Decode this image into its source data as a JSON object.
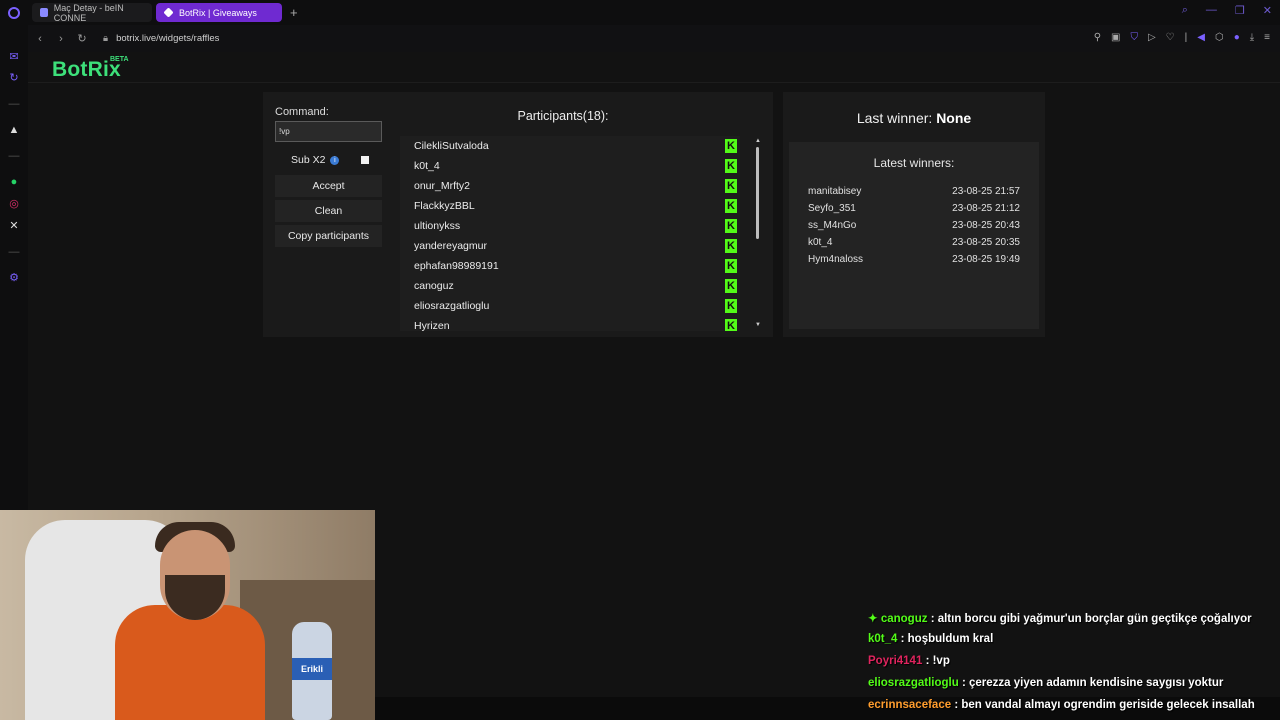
{
  "browser": {
    "tabs": [
      {
        "title": "Maç Detay - beIN CONNE"
      },
      {
        "title": "BotRix | Giveaways"
      }
    ],
    "new_tab": "+",
    "url": "botrix.live/widgets/raffles"
  },
  "brand": {
    "name": "BotRix",
    "badge": "BETA"
  },
  "command": {
    "label": "Command:",
    "value": "!vp",
    "sub_label": "Sub X2",
    "info": "i"
  },
  "buttons": {
    "accept": "Accept",
    "clean": "Clean",
    "copy": "Copy participants"
  },
  "participants": {
    "title": "Participants(18):",
    "platform_icon": "K",
    "items": [
      "CilekliSutvaloda",
      "k0t_4",
      "onur_Mrfty2",
      "FlackkyzBBL",
      "ultionykss",
      "yandereyagmur",
      "ephafan98989191",
      "canoguz",
      "eliosrazgatlioglu",
      "Hyrizen"
    ]
  },
  "last_winner": {
    "label": "Last winner:",
    "value": "None"
  },
  "latest_winners": {
    "title": "Latest winners:",
    "rows": [
      {
        "name": "manitabisey",
        "time": "23-08-25 21:57"
      },
      {
        "name": "Seyfo_351",
        "time": "23-08-25 21:12"
      },
      {
        "name": "ss_M4nGo",
        "time": "23-08-25 20:43"
      },
      {
        "name": "k0t_4",
        "time": "23-08-25 20:35"
      },
      {
        "name": "Hym4naloss",
        "time": "23-08-25 19:49"
      }
    ]
  },
  "webcam": {
    "bottle_label": "Erikli"
  },
  "chat": [
    {
      "user": "canoguz",
      "color": "#53fc18",
      "text": ": altın borcu gibi yağmur'un borçlar gün geçtikçe çoğalıyor"
    },
    {
      "user": "k0t_4",
      "color": "#53fc18",
      "text": ": hoşbuldum kral"
    },
    {
      "user": "Poyri4141",
      "color": "#e0245e",
      "text": ": !vp"
    },
    {
      "user": "eliosrazgatlioglu",
      "color": "#53fc18",
      "text": ": çerezza yiyen adamın kendisine saygısı yoktur"
    },
    {
      "user": "ecrinnsaceface",
      "color": "#ff9d2e",
      "text": ": ben vandal almayı ogrendim geriside gelecek insallah"
    }
  ],
  "colors": {
    "accent": "#3de07a",
    "kick": "#53fc18",
    "tab_active": "#6f2ad1"
  }
}
